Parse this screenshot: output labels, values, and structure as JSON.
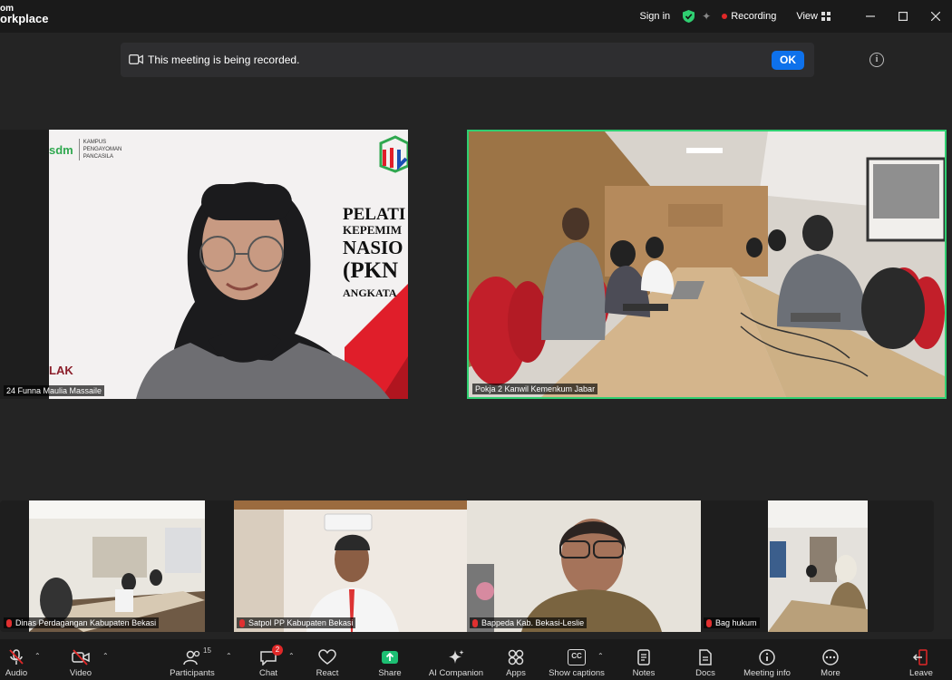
{
  "app": {
    "logo_line1": "om",
    "logo_line2": "orkplace"
  },
  "titlebar": {
    "sign_in": "Sign in",
    "recording": "Recording",
    "view": "View"
  },
  "notice": {
    "message": "This meeting is being recorded.",
    "ok": "OK"
  },
  "slide": {
    "header_left": "sdm",
    "header_sub1": "KAMPUS",
    "header_sub2": "PENGAYOMAN",
    "header_sub3": "PANCASILA",
    "line1": "PELATI",
    "line2": "KEPEMIM",
    "line3": "NASIO",
    "line4": "(PKN",
    "line5": "ANGKATA",
    "corner": "LAK"
  },
  "participants_main": [
    {
      "name": "24 Funna Maulia Massaile"
    },
    {
      "name": "Pokja 2 Kanwil Kemenkum Jabar"
    }
  ],
  "participants_strip": [
    {
      "name": "Dinas Perdagangan Kabupaten Bekasi"
    },
    {
      "name": "Satpol PP Kabupaten Bekasi"
    },
    {
      "name": "Bappeda Kab. Bekasi-Leslie"
    },
    {
      "name": "Bag hukum"
    }
  ],
  "toolbar": {
    "audio": "Audio",
    "video": "Video",
    "participants": "Participants",
    "participants_count": "15",
    "chat": "Chat",
    "chat_badge": "2",
    "react": "React",
    "share": "Share",
    "ai_companion": "AI Companion",
    "apps": "Apps",
    "show_captions": "Show captions",
    "cc": "CC",
    "notes": "Notes",
    "docs": "Docs",
    "meeting_info": "Meeting info",
    "more": "More",
    "leave": "Leave"
  },
  "colors": {
    "ok_button": "#0e71eb",
    "active_speaker": "#2fcf71",
    "share": "#1dbf73",
    "recording": "#e02828"
  }
}
